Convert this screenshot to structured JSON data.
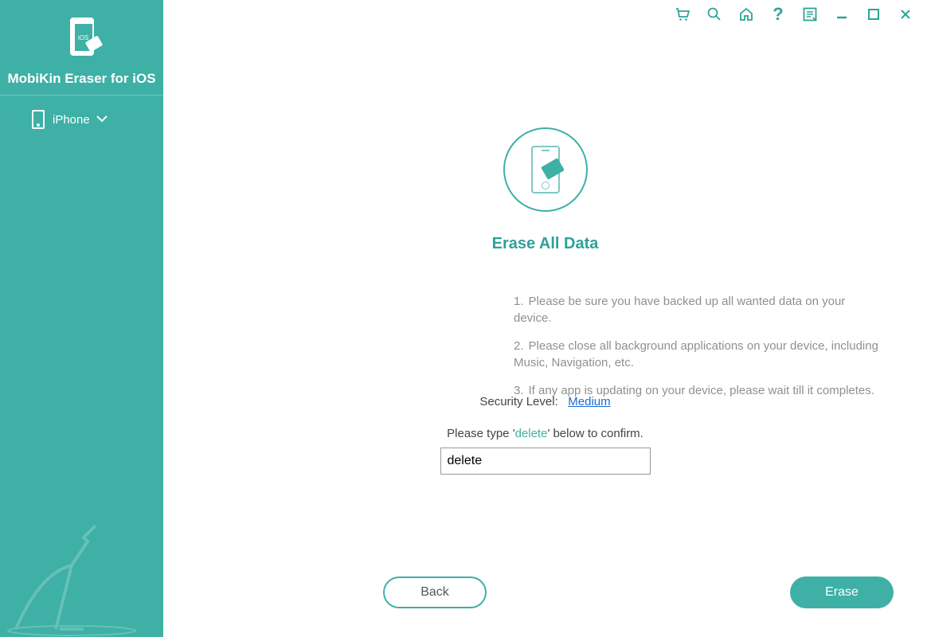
{
  "app": {
    "title": "MobiKin Eraser for iOS",
    "logo_badge": "iOS"
  },
  "sidebar": {
    "device_label": "iPhone"
  },
  "main": {
    "title": "Erase All Data",
    "instructions": [
      "Please be sure you have backed up all wanted data on your device.",
      "Please close all background applications on your device, including Music, Navigation, etc.",
      "If any app is updating on your device, please wait till it completes."
    ],
    "security_label": "Security Level:",
    "security_value": "Medium",
    "confirm_prefix": "Please type '",
    "confirm_word": "delete",
    "confirm_suffix": "' below to confirm.",
    "input_value": "delete",
    "back_label": "Back",
    "erase_label": "Erase"
  },
  "icons": {
    "cart": "cart-icon",
    "search": "search-icon",
    "home": "home-icon",
    "help": "help-icon",
    "feedback": "feedback-icon",
    "minimize": "minimize-icon",
    "maximize": "maximize-icon",
    "close": "close-icon"
  }
}
